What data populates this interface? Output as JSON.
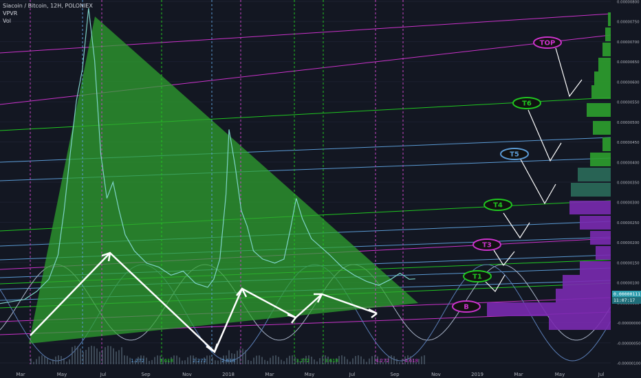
{
  "header": {
    "symbol_line": "Siacoin / Bitcoin, 12H, POLONIEX",
    "indicator_1": "VPVR",
    "indicator_2": "Vol"
  },
  "price_tags": {
    "last_price": "0.00000111",
    "countdown": "11:07:17"
  },
  "colors": {
    "background": "#131722",
    "triangle_fill": "#2fa52f",
    "green_line": "#20c820",
    "magenta_line": "#cc33cc",
    "blue_line": "#5b9bd5",
    "price_line": "#7ed3c8",
    "arrow": "#ffffff"
  },
  "chart_data": {
    "type": "line",
    "series": [],
    "x_tick_labels": [
      "Mar",
      "May",
      "Jul",
      "Sep",
      "Nov",
      "2018",
      "Mar",
      "May",
      "Jul",
      "Sep",
      "Nov",
      "2019",
      "Mar",
      "May",
      "Jul"
    ],
    "y_tick_labels": [
      "0.00000800",
      "0.00000750",
      "0.00000700",
      "0.00000650",
      "0.00000600",
      "0.00000550",
      "0.00000500",
      "0.00000450",
      "0.00000400",
      "0.00000350",
      "0.00000300",
      "0.00000250",
      "0.00000200",
      "0.00000150",
      "0.00000100",
      "0.00000050",
      "-0.00000000",
      "-0.00000050",
      "-0.00000100"
    ],
    "ylim": [
      -1e-06,
      8e-06
    ],
    "fib_labels": [
      "1.272",
      "1.618",
      "2.272",
      "2.618",
      "3.272",
      "3.618",
      "4.272",
      "4.618"
    ],
    "target_labels": [
      "TOP",
      "T6",
      "T5",
      "T4",
      "T3",
      "T1",
      "B"
    ],
    "price_path": [
      [
        0.0,
        5e-07
      ],
      [
        0.02,
        5.5e-07
      ],
      [
        0.04,
        6e-07
      ],
      [
        0.06,
        8e-07
      ],
      [
        0.08,
        1.1e-06
      ],
      [
        0.095,
        1.7e-06
      ],
      [
        0.105,
        2.8e-06
      ],
      [
        0.115,
        4.2e-06
      ],
      [
        0.125,
        5.5e-06
      ],
      [
        0.135,
        6.3e-06
      ],
      [
        0.145,
        7.8e-06
      ],
      [
        0.155,
        6.5e-06
      ],
      [
        0.165,
        4.2e-06
      ],
      [
        0.175,
        3.1e-06
      ],
      [
        0.185,
        3.5e-06
      ],
      [
        0.195,
        2.8e-06
      ],
      [
        0.205,
        2.2e-06
      ],
      [
        0.22,
        1.8e-06
      ],
      [
        0.24,
        1.5e-06
      ],
      [
        0.26,
        1.4e-06
      ],
      [
        0.28,
        1.2e-06
      ],
      [
        0.3,
        1.3e-06
      ],
      [
        0.32,
        1e-06
      ],
      [
        0.34,
        9e-07
      ],
      [
        0.35,
        1.1e-06
      ],
      [
        0.36,
        1.6e-06
      ],
      [
        0.37,
        3.2e-06
      ],
      [
        0.375,
        4.8e-06
      ],
      [
        0.385,
        3.9e-06
      ],
      [
        0.395,
        2.8e-06
      ],
      [
        0.405,
        2.4e-06
      ],
      [
        0.415,
        1.8e-06
      ],
      [
        0.43,
        1.6e-06
      ],
      [
        0.45,
        1.5e-06
      ],
      [
        0.465,
        1.6e-06
      ],
      [
        0.475,
        2.3e-06
      ],
      [
        0.485,
        3.1e-06
      ],
      [
        0.495,
        2.6e-06
      ],
      [
        0.51,
        2.1e-06
      ],
      [
        0.525,
        1.9e-06
      ],
      [
        0.54,
        1.7e-06
      ],
      [
        0.56,
        1.4e-06
      ],
      [
        0.58,
        1.2e-06
      ],
      [
        0.6,
        1.05e-06
      ],
      [
        0.62,
        9.5e-07
      ],
      [
        0.64,
        1.1e-06
      ],
      [
        0.655,
        1.25e-06
      ],
      [
        0.67,
        1.1e-06
      ],
      [
        0.68,
        1.11e-06
      ]
    ]
  }
}
